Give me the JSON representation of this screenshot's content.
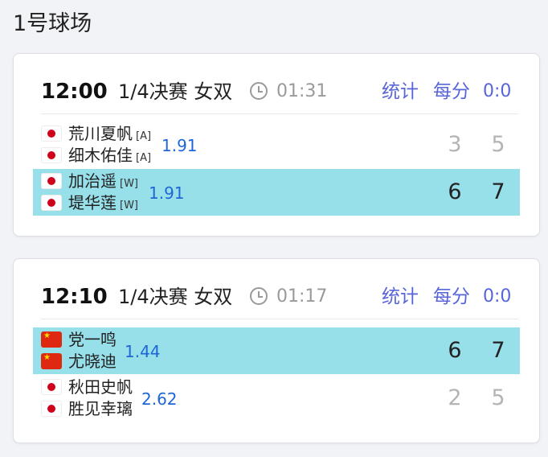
{
  "court": {
    "title": "1号球场"
  },
  "matches": [
    {
      "time": "12:00",
      "round": "1/4决赛 女双",
      "elapsed": "01:31",
      "tabs": {
        "stats": "统计",
        "points": "每分",
        "score": "0:0"
      },
      "teams": [
        {
          "result": "lose",
          "players": [
            {
              "name": "荒川夏帆",
              "seed": "[A]",
              "flag": "jp-flag-icon"
            },
            {
              "name": "细木佑佳",
              "seed": "[A]",
              "flag": "jp-flag-icon"
            }
          ],
          "odds": "1.91",
          "sets": [
            "3",
            "5"
          ]
        },
        {
          "result": "win",
          "players": [
            {
              "name": "加治遥",
              "seed": "[W]",
              "flag": "jp-flag-icon"
            },
            {
              "name": "堤华莲",
              "seed": "[W]",
              "flag": "jp-flag-icon"
            }
          ],
          "odds": "1.91",
          "sets": [
            "6",
            "7"
          ]
        }
      ]
    },
    {
      "time": "12:10",
      "round": "1/4决赛 女双",
      "elapsed": "01:17",
      "tabs": {
        "stats": "统计",
        "points": "每分",
        "score": "0:0"
      },
      "teams": [
        {
          "result": "win",
          "players": [
            {
              "name": "党一鸣",
              "seed": "",
              "flag": "cn-flag-icon"
            },
            {
              "name": "尤晓迪",
              "seed": "",
              "flag": "cn-flag-icon"
            }
          ],
          "odds": "1.44",
          "sets": [
            "6",
            "7"
          ]
        },
        {
          "result": "lose",
          "players": [
            {
              "name": "秋田史帆",
              "seed": "",
              "flag": "jp-flag-icon"
            },
            {
              "name": "胜见幸璃",
              "seed": "",
              "flag": "jp-flag-icon"
            }
          ],
          "odds": "2.62",
          "sets": [
            "2",
            "5"
          ]
        }
      ]
    }
  ],
  "colors": {
    "accent": "#5865d8",
    "odds": "#1f66d6",
    "winner_bg": "#97dfe9",
    "muted": "#9a9a9a"
  }
}
